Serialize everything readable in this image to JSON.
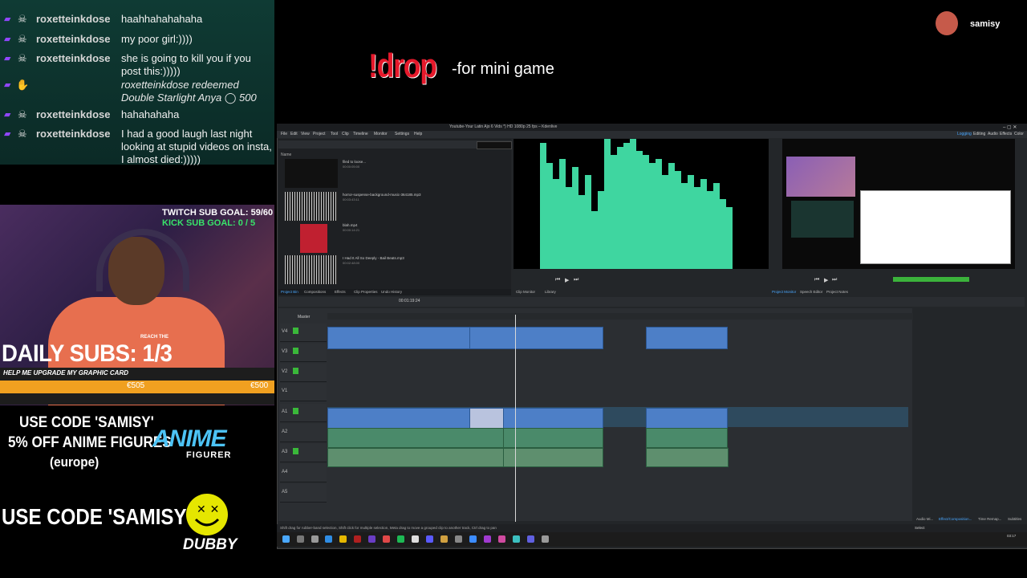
{
  "chat": {
    "messages": [
      {
        "user": "roxetteinkdose",
        "text": "haahhahahahaha"
      },
      {
        "user": "roxetteinkdose",
        "text": "my poor girl:))))"
      },
      {
        "user": "roxetteinkdose",
        "text": "she is going to kill you if you post this:)))))"
      },
      {
        "redeem": "roxetteinkdose redeemed Double Starlight Anya",
        "cost": "500"
      },
      {
        "user": "roxetteinkdose",
        "text": "hahahahaha"
      },
      {
        "user": "roxetteinkdose",
        "text": "I had a good laugh last night looking at stupid videos on insta, I almost died:)))))"
      }
    ]
  },
  "overlay": {
    "twitch_goal": "TWITCH SUB GOAL: 59/60",
    "kick_goal": "KICK SUB GOAL: 0 / 5",
    "reach_the": "REACH THE",
    "daily_subs": "DAILY SUBS: 1/3",
    "gpu_title": "HELP ME UPGRADE MY GRAPHIC CARD",
    "gpu_value": "€505",
    "gpu_goal": "€500",
    "code_line1": "USE CODE 'SAMISY'",
    "code_line2": "5% OFF ANIME FIGURES",
    "code_line3": "(europe)",
    "anime_logo": "ANIME",
    "figurer_logo": "FIGURER",
    "code_dubby": "USE CODE 'SAMISY'",
    "dubby_logo": "DUBBY",
    "drop_cmd": "!drop",
    "drop_desc": "-for mini game",
    "username": "samisy"
  },
  "editor": {
    "title": "Youtube-Your Latin Ajo 6 Vids *) HD 1080p 25 fps – Kdenlive",
    "menu": [
      "File",
      "Edit",
      "View",
      "Project",
      "Tool",
      "Clip",
      "Timeline",
      "Monitor",
      "Settings",
      "Help"
    ],
    "layouts": [
      "Logging",
      "Editing",
      "Audio",
      "Effects",
      "Color"
    ],
    "bin_header": "Name",
    "bin_items": [
      {
        "name": "filed to loose...",
        "sub": "00:00:05:00"
      },
      {
        "name": "horror-suspense-background-music-364185.mp3",
        "sub": "00:03:43:11"
      },
      {
        "name": "blah.mp4",
        "sub": "00:00:14:21"
      },
      {
        "name": "I Had It All So Deeply - Bail Beats.mp3",
        "sub": "00:02:48:00"
      }
    ],
    "bin_tabs": [
      "Project Bin",
      "Compositions",
      "Effects",
      "Clip Properties",
      "Undo History"
    ],
    "clip_monitor_tabs": [
      "Clip Monitor",
      "Library"
    ],
    "project_monitor_tabs": [
      "Project Monitor",
      "Speech Editor",
      "Project Notes"
    ],
    "timecode": "00:01:19:24",
    "track_master": "Master",
    "track_labels": [
      "V4",
      "V3",
      "V2",
      "V1",
      "A1",
      "A2",
      "A3",
      "A4",
      "A5"
    ],
    "effect_tabs": [
      "Audio Mi...",
      "Effect/Composition...",
      "Time Remap...",
      "Subtitles"
    ],
    "status": "Shift drag for rubber-band selection, Shift click for multiple selection, Meta drag to move a grouped clip to another track, Ctrl drag to pan",
    "select_label": "Select",
    "clock": "03:17"
  },
  "colors": {
    "accent_green": "#3ab83a",
    "video_clip": "#4d7fc7",
    "audio_clip": "#4a8a6a",
    "drop_red": "#e5192b",
    "spectrum": "#3fd6a0"
  }
}
